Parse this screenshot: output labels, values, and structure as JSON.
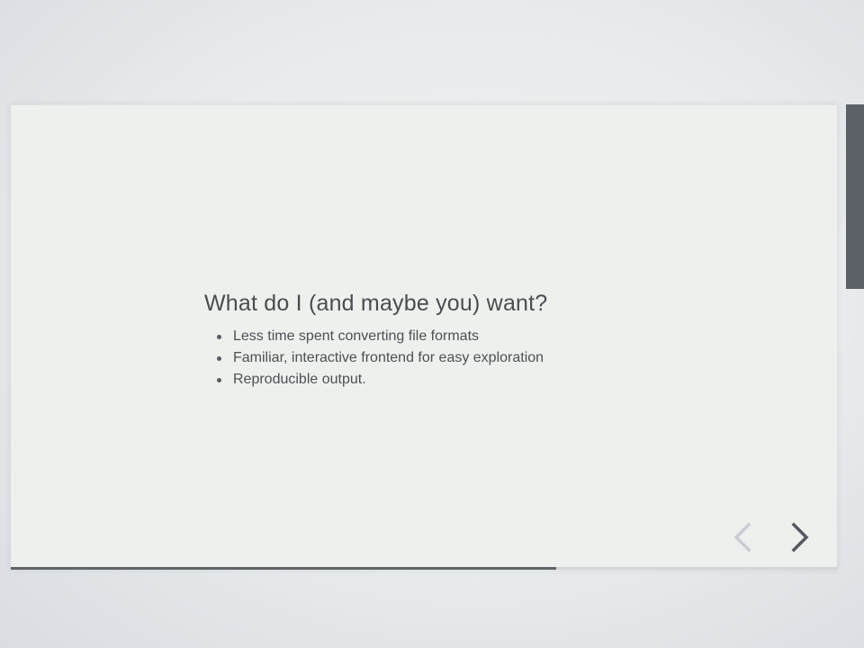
{
  "slide": {
    "title": "What do I (and maybe you) want?",
    "bullets": [
      "Less time spent converting file formats",
      "Familiar, interactive frontend for easy exploration",
      "Reproducible output."
    ]
  },
  "navigation": {
    "prev_icon": "chevron-left-icon",
    "next_icon": "chevron-right-icon",
    "prev_enabled": false,
    "next_enabled": true
  },
  "progress": {
    "fraction": 0.66
  },
  "colors": {
    "background": "#e8ebec",
    "slide_background": "#eef0ee",
    "text": "#4a4d50",
    "progress_fill": "#5f6468",
    "nav_active": "#55595d",
    "nav_disabled": "#c9cdd3",
    "scrollbar": "#5b6166"
  }
}
